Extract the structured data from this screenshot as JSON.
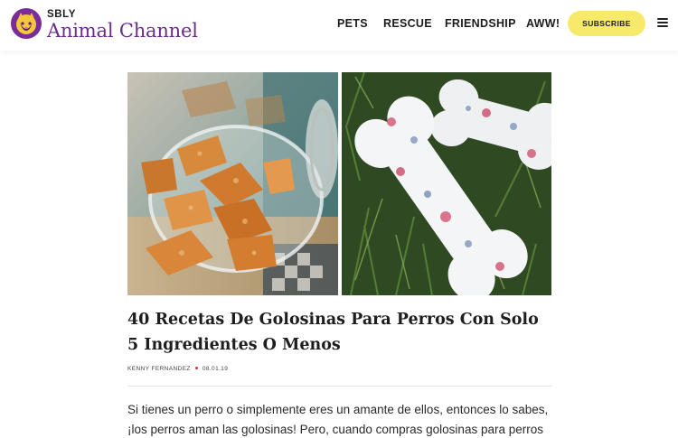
{
  "brand": {
    "small": "SBLY",
    "big": "Animal Channel",
    "colors": {
      "purple": "#6b2a8c",
      "yellow": "#f7ea6a"
    }
  },
  "nav": {
    "items": [
      "PETS",
      "RESCUE",
      "FRIENDSHIP",
      "AWW!"
    ],
    "subscribe": "SUBSCRIBE"
  },
  "icons": {
    "logo": "cat-dog-logo-icon",
    "menu": "hamburger-menu-icon"
  },
  "images": {
    "left": "jar of dog treats",
    "right": "bone-shaped frozen dog treats on grass"
  },
  "article": {
    "title": "40 Recetas De Golosinas Para Perros Con Solo 5 Ingredientes O Menos",
    "author": "KENNY FERNANDEZ",
    "date": "08.01.19",
    "intro": "Si tienes un perro o simplemente eres un amante de ellos, entonces lo sabes, ¡los perros aman las golosinas! Pero, cuando compras golosinas para perros en la"
  }
}
